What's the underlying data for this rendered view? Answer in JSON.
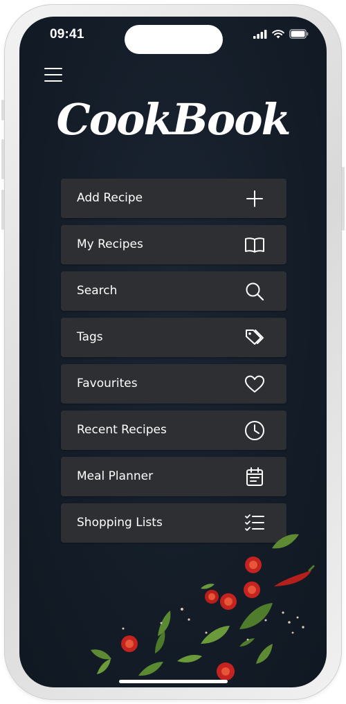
{
  "status_bar": {
    "time": "09:41"
  },
  "header": {
    "menu_icon": "hamburger-menu-icon"
  },
  "logo": {
    "text": "CookBook"
  },
  "menu": {
    "items": [
      {
        "label": "Add Recipe",
        "icon": "plus-icon"
      },
      {
        "label": "My Recipes",
        "icon": "open-book-icon"
      },
      {
        "label": "Search",
        "icon": "search-icon"
      },
      {
        "label": "Tags",
        "icon": "tags-icon"
      },
      {
        "label": "Favourites",
        "icon": "heart-icon"
      },
      {
        "label": "Recent Recipes",
        "icon": "clock-icon"
      },
      {
        "label": "Meal Planner",
        "icon": "calendar-icon"
      },
      {
        "label": "Shopping Lists",
        "icon": "checklist-icon"
      }
    ]
  },
  "colors": {
    "background": "#131c27",
    "menu_item": "#2e2f33",
    "text": "#ffffff",
    "chili": "#c4231f",
    "basil": "#5d8a33"
  }
}
